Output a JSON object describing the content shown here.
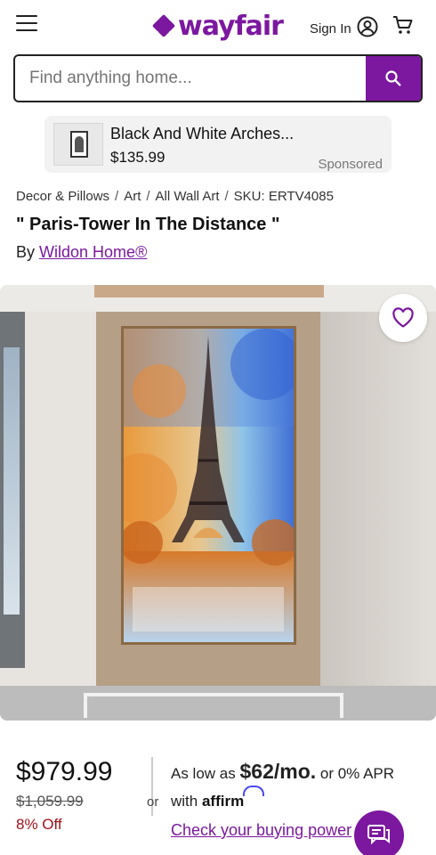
{
  "header": {
    "logo_text": "wayfair",
    "signin_label": "Sign In",
    "icons": [
      "menu-icon",
      "user-icon",
      "cart-icon"
    ]
  },
  "search": {
    "placeholder": "Find anything home..."
  },
  "sponsored": {
    "title": "Black And White Arches...",
    "price": "$135.99",
    "label": "Sponsored"
  },
  "breadcrumb": {
    "items": [
      "Decor & Pillows",
      "Art",
      "All Wall Art",
      "SKU: ERTV4085"
    ]
  },
  "product": {
    "title": "\" Paris-Tower In The Distance \"",
    "by_prefix": "By",
    "brand": "Wildon Home®"
  },
  "pricing": {
    "price": "$979.99",
    "old_price": "$1,059.99",
    "discount": "8% Off",
    "or_label": "or",
    "affirm_prefix": "As low as",
    "affirm_amount": "$62/mo.",
    "affirm_suffix": "or 0% APR",
    "affirm_with": "with",
    "affirm_brand": "affirm",
    "check_link": "Check your buying power"
  },
  "colors": {
    "brand": "#7b189f",
    "discount": "#a1111a"
  }
}
